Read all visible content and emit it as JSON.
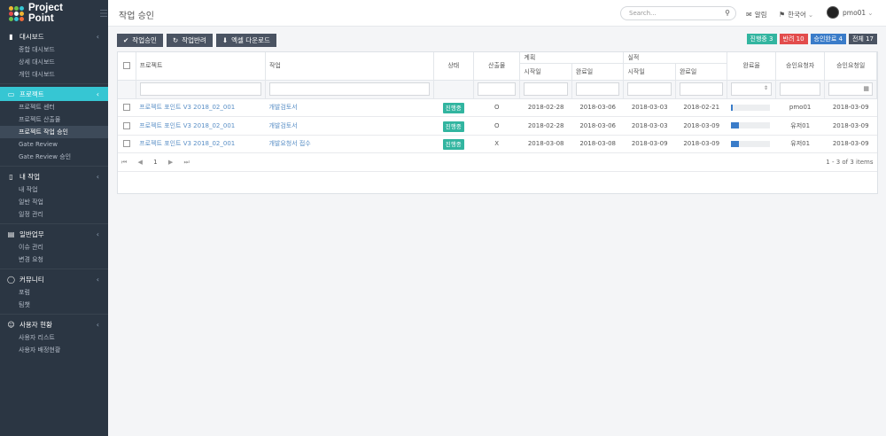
{
  "app": {
    "name": "Project Point",
    "logo_colors": [
      "#f2b632",
      "#6cc24a",
      "#36c6d3",
      "#e24c4c",
      "#ffffff",
      "#f2b632",
      "#6cc24a",
      "#36c6d3",
      "#f26b3a"
    ]
  },
  "header": {
    "page_title": "작업 승인",
    "search_placeholder": "Search...",
    "alerts_label": "알림",
    "language_label": "한국어",
    "username": "pmo01"
  },
  "sidebar": {
    "sections": [
      {
        "label": "대시보드",
        "icon": "bar-chart-icon",
        "items": [
          "종합 대시보드",
          "상세 대시보드",
          "개인 대시보드"
        ]
      },
      {
        "label": "프로젝트",
        "icon": "monitor-icon",
        "items": [
          "프로젝트 센터",
          "프로젝트 산출물",
          "프로젝트 작업 승인",
          "Gate Review",
          "Gate Review 승인"
        ]
      },
      {
        "label": "내 작업",
        "icon": "tablet-icon",
        "items": [
          "내 작업",
          "일반 작업",
          "일정 관리"
        ]
      },
      {
        "label": "일반업무",
        "icon": "document-icon",
        "items": [
          "이슈 관리",
          "변경 요청"
        ]
      },
      {
        "label": "커뮤니티",
        "icon": "chat-icon",
        "items": [
          "포럼",
          "팀챗"
        ]
      },
      {
        "label": "사용자 현황",
        "icon": "user-icon",
        "items": [
          "사용자 리스트",
          "사용자 배정현황"
        ]
      }
    ]
  },
  "toolbar": {
    "approve_label": "작업승인",
    "reject_label": "작업반려",
    "excel_label": "엑셀 다운로드"
  },
  "badges": {
    "in_progress": "진행중 3",
    "rejected": "반려 10",
    "approved": "승인완료 4",
    "total": "전체 17"
  },
  "colors": {
    "sidebar_bg": "#2b3643",
    "accent": "#36c6d3",
    "button": "#4a5362",
    "badge_in_progress": "#32b5a0",
    "badge_rejected": "#e24c4c",
    "badge_approved": "#3a7cc9",
    "badge_total": "#4a5362",
    "progress_fill": "#3a7cc9"
  },
  "table": {
    "group_headers": {
      "plan": "계획",
      "actual": "실적"
    },
    "columns": {
      "project": "프로젝트",
      "task": "작업",
      "status": "상태",
      "deliverable": "산출물",
      "plan_start": "시작일",
      "plan_end": "완료일",
      "actual_start": "시작일",
      "actual_end": "완료일",
      "completion": "완료율",
      "requester": "승인요청자",
      "request_date": "승인요청일"
    },
    "rows": [
      {
        "project": "프로젝트 포인트 V3 2018_02_001",
        "task": "개발검토서",
        "status": "진행중",
        "deliverable": "O",
        "plan_start": "2018-02-28",
        "plan_end": "2018-03-06",
        "actual_start": "2018-03-03",
        "actual_end": "2018-02-21",
        "completion": 0.05,
        "requester": "pmo01",
        "request_date": "2018-03-09"
      },
      {
        "project": "프로젝트 포인트 V3 2018_02_001",
        "task": "개발검토서",
        "status": "진행중",
        "deliverable": "O",
        "plan_start": "2018-02-28",
        "plan_end": "2018-03-06",
        "actual_start": "2018-03-03",
        "actual_end": "2018-03-09",
        "completion": 0.2,
        "requester": "유저01",
        "request_date": "2018-03-09"
      },
      {
        "project": "프로젝트 포인트 V3 2018_02_001",
        "task": "개발요청서 접수",
        "status": "진행중",
        "deliverable": "X",
        "plan_start": "2018-03-08",
        "plan_end": "2018-03-08",
        "actual_start": "2018-03-09",
        "actual_end": "2018-03-09",
        "completion": 0.2,
        "requester": "유저01",
        "request_date": "2018-03-09"
      }
    ],
    "pager": {
      "current_page": "1",
      "summary": "1 - 3 of 3 items"
    }
  }
}
